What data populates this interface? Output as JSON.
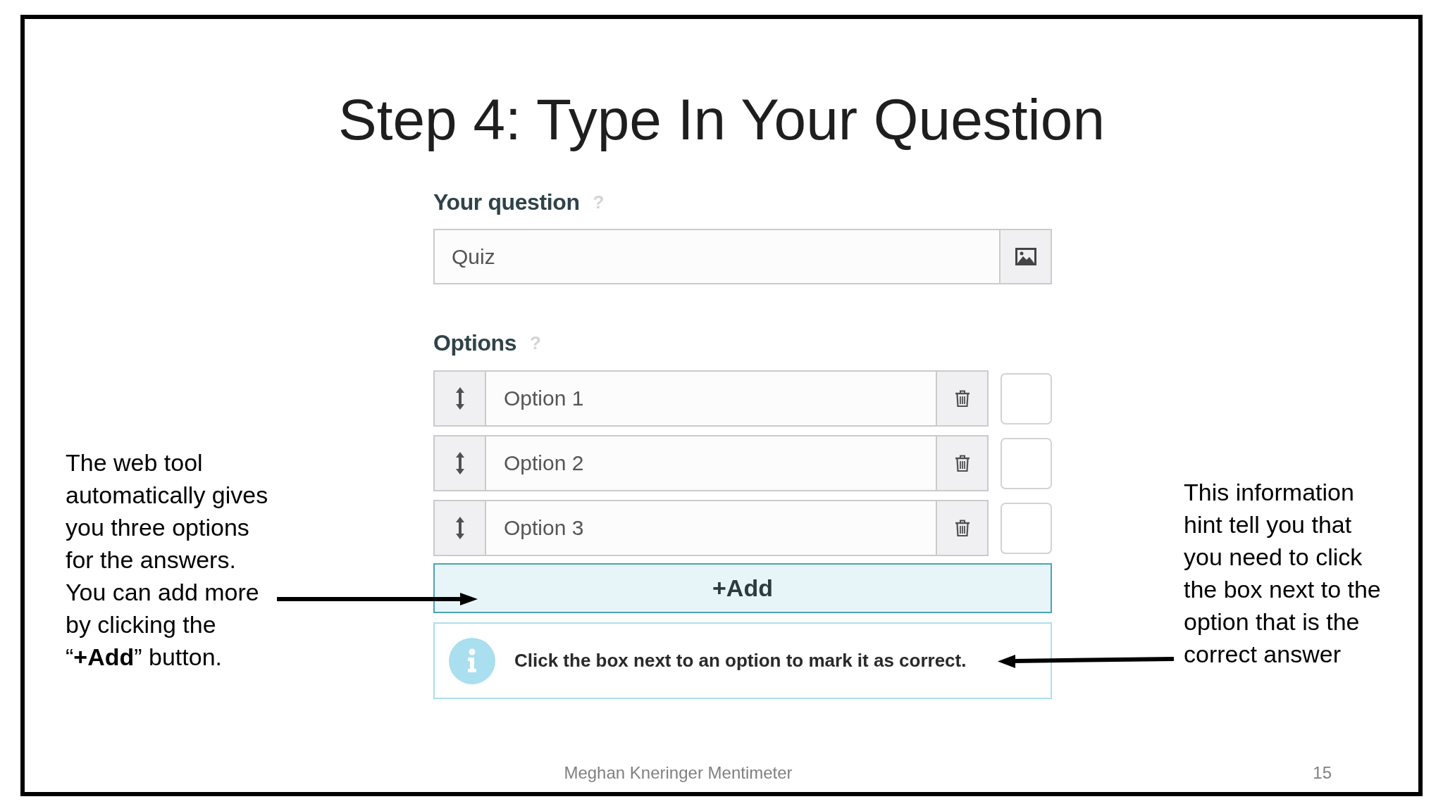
{
  "slide": {
    "title": "Step 4: Type In Your Question",
    "footer": "Meghan Kneringer Mentimeter",
    "page_number": "15"
  },
  "question": {
    "label": "Your question",
    "help": "?",
    "value": "Quiz"
  },
  "options": {
    "label": "Options",
    "help": "?",
    "items": [
      {
        "value": "Option 1",
        "checked": false
      },
      {
        "value": "Option 2",
        "checked": false
      },
      {
        "value": "Option 3",
        "checked": false
      }
    ]
  },
  "add_button": {
    "label": "+Add"
  },
  "info": {
    "text": "Click the box next to an option to mark it as correct."
  },
  "annotations": {
    "left": "The web tool\nautomatically gives\nyou three options\nfor the answers.\nYou can add more\nby clicking the\n“**+Add**” button.",
    "right": "This information\nhint tell you that\nyou need to click\nthe box next to the\noption that is the\ncorrect answer"
  }
}
